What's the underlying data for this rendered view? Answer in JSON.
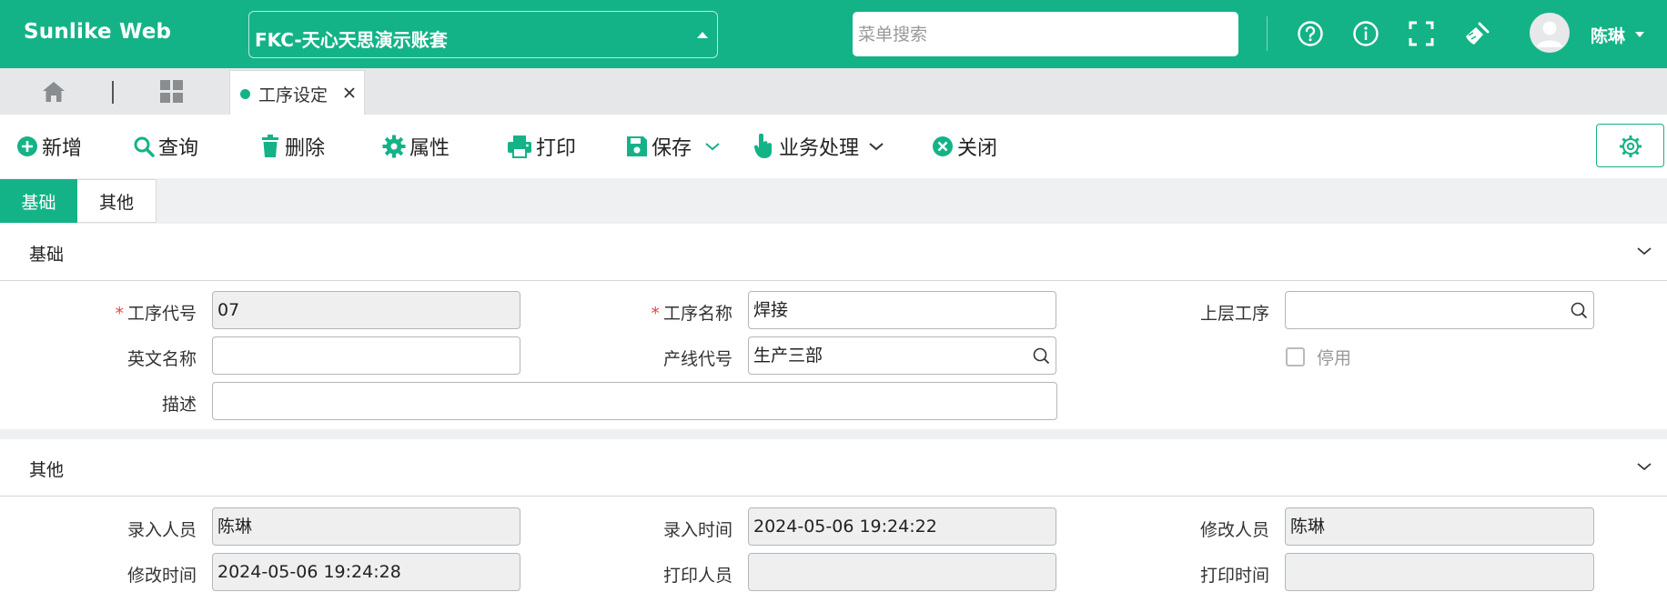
{
  "app": {
    "brand": "Sunlike Web",
    "account": "FKC-天心天思演示账套",
    "search_placeholder": "菜单搜索",
    "user": "陈琳"
  },
  "tabs": [
    {
      "label": "工序设定",
      "active": true
    }
  ],
  "toolbar": {
    "add": "新增",
    "query": "查询",
    "delete": "删除",
    "props": "属性",
    "print": "打印",
    "save": "保存",
    "business": "业务处理",
    "close": "关闭"
  },
  "section_tabs": {
    "basic": "基础",
    "other": "其他"
  },
  "basic": {
    "title": "基础",
    "fields": {
      "proc_code": {
        "label": "工序代号",
        "value": "07"
      },
      "proc_name": {
        "label": "工序名称",
        "value": "焊接"
      },
      "upper_proc": {
        "label": "上层工序",
        "value": ""
      },
      "en_name": {
        "label": "英文名称",
        "value": ""
      },
      "line_code": {
        "label": "产线代号",
        "value": "生产三部"
      },
      "disabled": {
        "label": "停用",
        "checked": false
      },
      "desc": {
        "label": "描述",
        "value": ""
      }
    }
  },
  "other": {
    "title": "其他",
    "fields": {
      "entry_user": {
        "label": "录入人员",
        "value": "陈琳"
      },
      "entry_time": {
        "label": "录入时间",
        "value": "2024-05-06 19:24:22"
      },
      "mod_user": {
        "label": "修改人员",
        "value": "陈琳"
      },
      "mod_time": {
        "label": "修改时间",
        "value": "2024-05-06 19:24:28"
      },
      "print_user": {
        "label": "打印人员",
        "value": ""
      },
      "print_time": {
        "label": "打印时间",
        "value": ""
      }
    }
  },
  "colors": {
    "accent": "#14b387",
    "required": "#e04848"
  },
  "icons": [
    "help-icon",
    "info-icon",
    "fullscreen-icon",
    "broom-icon",
    "user-avatar-icon",
    "home-icon",
    "grid-icon",
    "close-icon",
    "plus-circle-icon",
    "search-icon",
    "trash-icon",
    "gear-icon",
    "printer-icon",
    "save-icon",
    "hand-pointer-icon",
    "x-circle-icon",
    "chevron-down-icon"
  ]
}
